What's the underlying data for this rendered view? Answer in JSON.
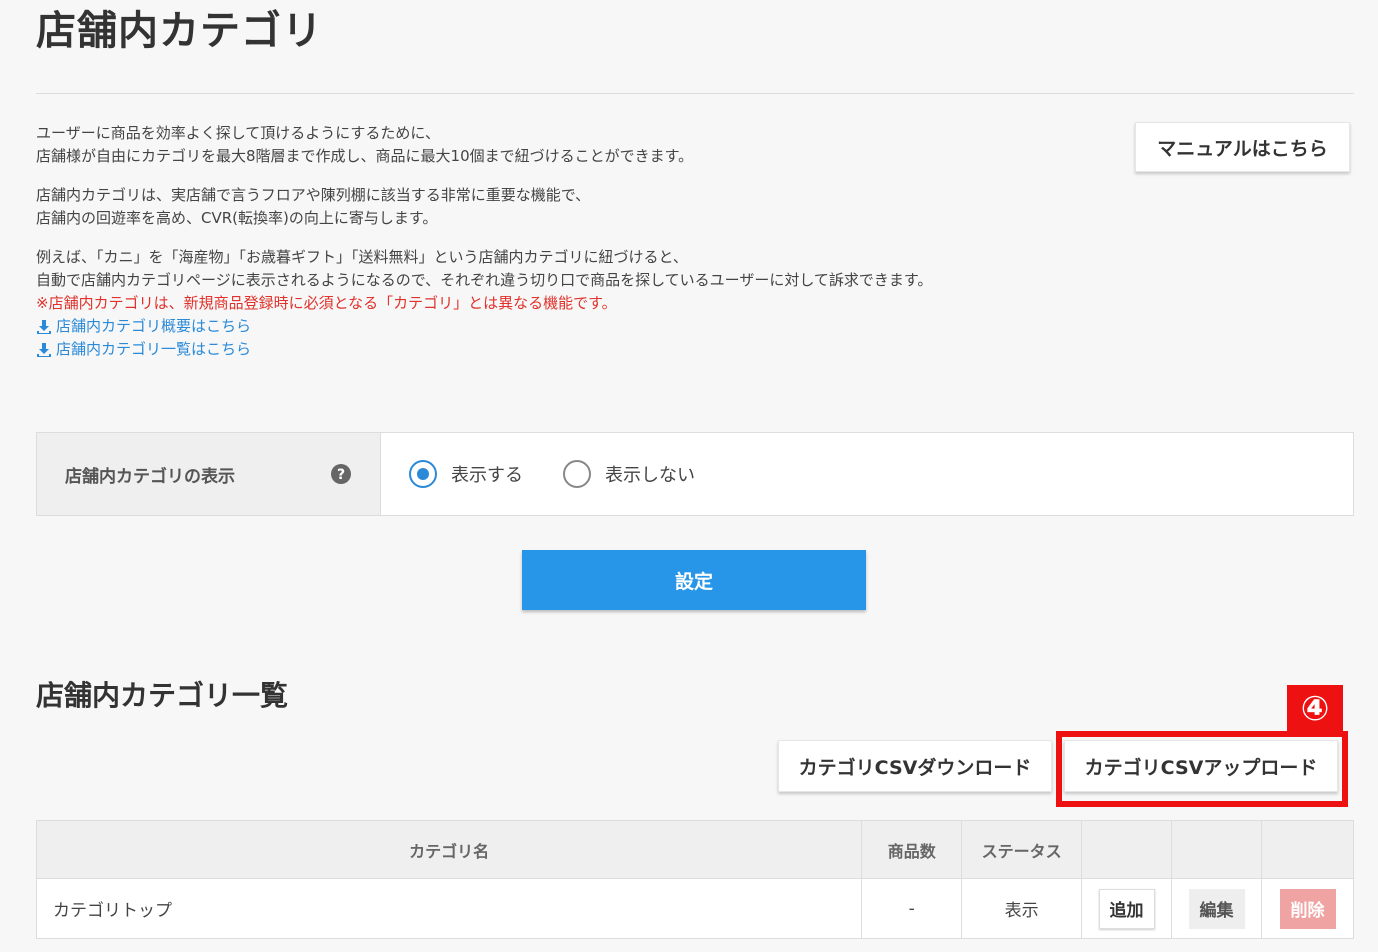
{
  "page_title": "店舗内カテゴリ",
  "manual_button": "マニュアルはこちら",
  "intro": {
    "p1_line1": "ユーザーに商品を効率よく探して頂けるようにするために、",
    "p1_line2": "店舗様が自由にカテゴリを最大8階層まで作成し、商品に最大10個まで紐づけることができます。",
    "p2_line1": "店舗内カテゴリは、実店舗で言うフロアや陳列棚に該当する非常に重要な機能で、",
    "p2_line2": "店舗内の回遊率を高め、CVR(転換率)の向上に寄与します。",
    "p3_line1": "例えば、「カニ」を「海産物」「お歳暮ギフト」「送料無料」という店舗内カテゴリに紐づけると、",
    "p3_line2": "自動で店舗内カテゴリページに表示されるようになるので、それぞれ違う切り口で商品を探しているユーザーに対して訴求できます。",
    "warning": "※店舗内カテゴリは、新規商品登録時に必須となる「カテゴリ」とは異なる機能です。",
    "link1": "店舗内カテゴリ概要はこちら",
    "link2": "店舗内カテゴリ一覧はこちら"
  },
  "display_setting": {
    "label": "店舗内カテゴリの表示",
    "option_show": "表示する",
    "option_hide": "表示しない",
    "selected": "表示する"
  },
  "submit_button": "設定",
  "list_section_title": "店舗内カテゴリ一覧",
  "annotation_number": "④",
  "csv_download_button": "カテゴリCSVダウンロード",
  "csv_upload_button": "カテゴリCSVアップロード",
  "table": {
    "headers": [
      "カテゴリ名",
      "商品数",
      "ステータス",
      "",
      "",
      ""
    ],
    "rows": [
      {
        "name": "カテゴリトップ",
        "count": "-",
        "status": "表示",
        "add": "追加",
        "edit": "編集",
        "delete": "削除"
      }
    ]
  },
  "colors": {
    "primary": "#2796e8",
    "link": "#2a8ad8",
    "warning": "#e0322b",
    "annotation": "#ee1111"
  }
}
